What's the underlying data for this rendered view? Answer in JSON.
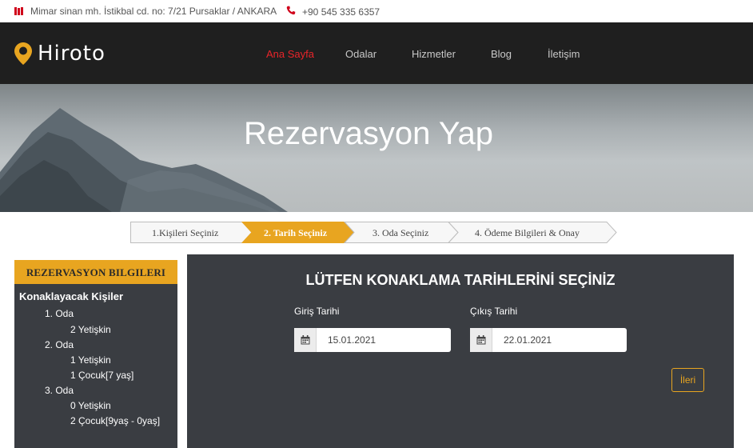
{
  "topbar": {
    "address": "Mimar sinan mh. İstikbal cd. no: 7/21 Pursaklar / ANKARA",
    "phone": "+90 545 335 6357",
    "accent_color": "#d0021b",
    "icons": [
      "map-icon",
      "phone-icon"
    ]
  },
  "nav": {
    "logo_text": "Hiroto",
    "items": [
      {
        "label": "Ana Sayfa",
        "active": true
      },
      {
        "label": "Odalar",
        "active": false
      },
      {
        "label": "Hizmetler",
        "active": false
      },
      {
        "label": "Blog",
        "active": false
      },
      {
        "label": "İletişim",
        "active": false
      }
    ],
    "active_color": "#e8252a"
  },
  "hero": {
    "title": "Rezervasyon Yap"
  },
  "steps": [
    {
      "label": "1.Kişileri Seçiniz",
      "active": false
    },
    {
      "label": "2. Tarih Seçiniz",
      "active": true
    },
    {
      "label": "3. Oda Seçiniz",
      "active": false
    },
    {
      "label": "4. Ödeme Bilgileri & Onay",
      "active": false
    }
  ],
  "sidebar": {
    "header": "REZERVASYON BILGILERI",
    "subtitle": "Konaklayacak Kişiler",
    "rooms": [
      {
        "name": "1. Oda",
        "lines": [
          "2 Yetişkin"
        ]
      },
      {
        "name": "2. Oda",
        "lines": [
          "1 Yetişkin",
          "1 Çocuk[7 yaş]"
        ]
      },
      {
        "name": "3. Oda",
        "lines": [
          "0 Yetişkin",
          "2 Çocuk[9yaş - 0yaş]"
        ]
      }
    ]
  },
  "form": {
    "title": "LÜTFEN KONAKLAMA TARİHLERİNİ SEÇİNİZ",
    "checkin_label": "Giriş Tarihi",
    "checkin_value": "15.01.2021",
    "checkout_label": "Çıkış Tarihi",
    "checkout_value": "22.01.2021",
    "next_label": "İleri",
    "accent_color": "#e8a520"
  }
}
